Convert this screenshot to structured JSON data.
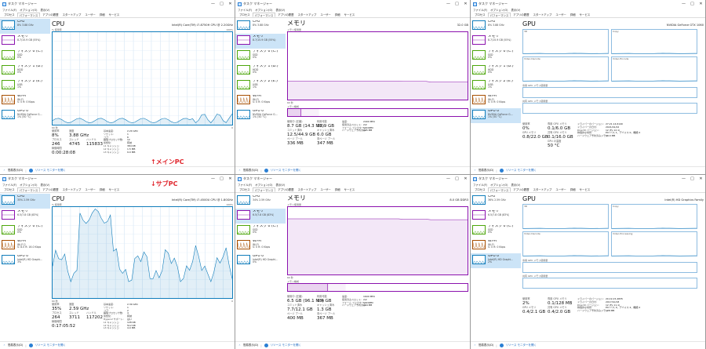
{
  "app": {
    "title": "タスク マネージャー",
    "menu": [
      "ファイル(F)",
      "オプション(O)",
      "表示(V)"
    ],
    "tabs": [
      "プロセス",
      "パフォーマンス",
      "アプリの履歴",
      "スタートアップ",
      "ユーザー",
      "詳細",
      "サービス"
    ],
    "active_tab": "パフォーマンス",
    "controls": [
      "—",
      "□",
      "✕"
    ]
  },
  "footer": {
    "less": "簡易表示(D)",
    "monitor": "リソース モニターを開く"
  },
  "labels": {
    "main_pc": "↑メインPC",
    "sub_pc": "↓サブPC"
  },
  "main_pc": {
    "sidebar": [
      {
        "title": "CPU",
        "sub": "8% 3.88 GHz",
        "kind": "cpu"
      },
      {
        "title": "メモリ",
        "sub": "8.7/15.9 GB (55%)",
        "kind": "mem"
      },
      {
        "title": "ディスク 0 (C:)",
        "sub": "SSD",
        "sub2": "0%",
        "kind": "disk"
      },
      {
        "title": "ディスク 1 (D:)",
        "sub": "HDD",
        "sub2": "0%",
        "kind": "disk"
      },
      {
        "title": "ディスク 2 (E:)",
        "sub": "USB",
        "sub2": "1%",
        "kind": "disk"
      },
      {
        "title": "Wi-Fi",
        "sub": "Wi-Fi",
        "sub2": "S: 0 R: 0 Kbps",
        "kind": "wifi"
      },
      {
        "title": "GPU 0",
        "sub": "NVIDIA GeForce G...",
        "sub2": "1% (50 °C)",
        "kind": "gpu"
      }
    ],
    "cpu": {
      "title": "CPU",
      "device": "Intel(R) Core(TM) i7-8750H CPU @ 2.20GHz",
      "graph_top": "% 使用率",
      "graph_max": "100%",
      "graph_time": "60 秒",
      "graph_min": "0",
      "usage_label": "使用率",
      "usage": "8%",
      "speed_label": "速度",
      "speed": "3.88 GHz",
      "proc_label": "プロセス",
      "proc": "246",
      "thr_label": "スレッド",
      "thr": "4745",
      "hnd_label": "ハンドル",
      "hnd": "115833",
      "uptime_label": "稼働時間",
      "uptime": "0:00:28:08",
      "specs": [
        [
          "基本速度:",
          "2.20 GHz"
        ],
        [
          "ソケット:",
          "1"
        ],
        [
          "コア:",
          "6"
        ],
        [
          "論理プロセッサ数:",
          "12"
        ],
        [
          "仮想化:",
          "有効"
        ],
        [
          "L1 キャッシュ:",
          "384 KB"
        ],
        [
          "L2 キャッシュ:",
          "1.5 MB"
        ],
        [
          "L3 キャッシュ:",
          "9.0 MB"
        ]
      ]
    },
    "mem": {
      "title": "メモリ",
      "total": "32.0 GB",
      "graph_top": "メモリ使用量",
      "graph_time": "60 秒",
      "composition": "メモリ構成",
      "inuse_label": "使用中 (圧縮)",
      "inuse": "8.7 GB (14.3 MB)",
      "avail_label": "利用可能",
      "avail": "22.9 GB",
      "commit_label": "コミット済み",
      "commit": "12.5/44.9 GB",
      "cached_label": "キャッシュ済み",
      "cached": "6.0 GB",
      "paged_label": "ページ プール",
      "paged": "336 MB",
      "nonpaged_label": "非ページ プール",
      "nonpaged": "347 MB",
      "specs": [
        [
          "速度:",
          "2400 MHz"
        ],
        [
          "使用済みスロット:",
          "2/2"
        ],
        [
          "フォーム ファクター:",
          "SODIMM"
        ],
        [
          "ハードウェア予約済み:",
          "105 MB"
        ]
      ]
    },
    "gpu": {
      "title": "GPU",
      "device": "NVIDIA GeForce GTX 1060",
      "engines": [
        "3D",
        "Copy",
        "Video Decode",
        "Video Encode"
      ],
      "shared_label": "共有 GPU メモリ使用量",
      "dedicated_label": "専用 GPU メモリ使用量",
      "usage_label": "使用率",
      "usage": "0%",
      "dedmem_label": "専用 GPU メモリ",
      "dedmem": "0.1/6.0 GB",
      "gpumem_label": "GPU メモリ",
      "gpumem": "0.8/22.0 GB",
      "sharedmem_label": "共有 GPU メモリ",
      "sharedmem": "0.1/16.0 GB",
      "temp_label": "GPU の温度",
      "temp": "50 °C",
      "specs": [
        [
          "ドライバーのバージョン:",
          "27.21.14.6140"
        ],
        [
          "ドライバーの日付:",
          "2021/01/22"
        ],
        [
          "DirectX バージョン:",
          "12 (FL 12.1)"
        ],
        [
          "物理的な場所:",
          "PCI バス 1、デバイス 0、機能 0"
        ],
        [
          "ハードウェア予約済みメモリ:",
          "90.0 MB"
        ]
      ]
    }
  },
  "sub_pc": {
    "sidebar_cpu": [
      {
        "title": "CPU",
        "sub": "35% 2.59 GHz",
        "kind": "cpu"
      },
      {
        "title": "メモリ",
        "sub": "6.5/7.8 GB (83%)",
        "kind": "mem"
      },
      {
        "title": "ディスク 0 (C:)",
        "sub": "SSD",
        "sub2": "0%",
        "kind": "disk"
      },
      {
        "title": "Wi-Fi",
        "sub": "Wi-Fi 2",
        "sub2": "S: 8.0 R: 16.0 Kbps",
        "kind": "wifi"
      },
      {
        "title": "GPU 0",
        "sub": "Intel(R) HD Graphi...",
        "sub2": "3%",
        "kind": "gpu"
      }
    ],
    "sidebar_mem": [
      {
        "title": "CPU",
        "sub": "34% 2.59 GHz",
        "kind": "cpu"
      },
      {
        "title": "メモリ",
        "sub": "6.5/7.8 GB (83%)",
        "kind": "mem"
      },
      {
        "title": "ディスク 0 (C:)",
        "sub": "SSD",
        "sub2": "0%",
        "kind": "disk"
      },
      {
        "title": "Wi-Fi",
        "sub": "Wi-Fi",
        "sub2": "S: 0 R: 0 Kbps",
        "kind": "wifi"
      },
      {
        "title": "GPU 0",
        "sub": "Intel(R) HD Graphi...",
        "sub2": "0%",
        "kind": "gpu"
      }
    ],
    "sidebar_gpu": [
      {
        "title": "CPU",
        "sub": "36% 2.59 GHz",
        "kind": "cpu"
      },
      {
        "title": "メモリ",
        "sub": "6.5/7.8 GB (83%)",
        "kind": "mem"
      },
      {
        "title": "ディスク 0 (C:)",
        "sub": "SSD",
        "sub2": "0%",
        "kind": "disk"
      },
      {
        "title": "Wi-Fi",
        "sub": "Wi-Fi",
        "sub2": "S: 0 R: 0 Kbps",
        "kind": "wifi"
      },
      {
        "title": "GPU 0",
        "sub": "Intel(R) HD Graphi...",
        "sub2": "2%",
        "kind": "gpu"
      }
    ],
    "cpu": {
      "title": "CPU",
      "device": "Intel(R) Core(TM) i7-4500U CPU @ 1.80GHz",
      "graph_top": "% 使用率",
      "graph_max": "100%",
      "graph_time": "60 秒",
      "graph_min": "0",
      "usage_label": "使用率",
      "usage": "35%",
      "speed_label": "速度",
      "speed": "2.59 GHz",
      "proc_label": "プロセス",
      "proc": "264",
      "thr_label": "スレッド",
      "thr": "3711",
      "hnd_label": "ハンドル",
      "hnd": "117202",
      "uptime_label": "稼働時間",
      "uptime": "0:17:05:52",
      "specs": [
        [
          "基本速度:",
          "2.39 GHz"
        ],
        [
          "ソケット:",
          "1"
        ],
        [
          "コア:",
          "2"
        ],
        [
          "論理プロセッサ数:",
          "4"
        ],
        [
          "仮想化:",
          "有効"
        ],
        [
          "Hyper-V サポート:",
          "はい"
        ],
        [
          "L1 キャッシュ:",
          "128 KB"
        ],
        [
          "L2 キャッシュ:",
          "512 KB"
        ],
        [
          "L3 キャッシュ:",
          "4.0 MB"
        ]
      ]
    },
    "mem": {
      "title": "メモリ",
      "total": "8.0 GB DDR3",
      "graph_top": "メモリ使用量",
      "graph_time": "60 秒",
      "composition": "メモリ構成",
      "inuse_label": "使用中 (圧縮)",
      "inuse": "6.5 GB (96.1 MB)",
      "avail_label": "利用可能",
      "avail": "1.4 GB",
      "commit_label": "コミット済み",
      "commit": "7.7/12.1 GB",
      "cached_label": "キャッシュ済み",
      "cached": "1.3 GB",
      "paged_label": "ページ プール",
      "paged": "400 MB",
      "nonpaged_label": "非ページ プール",
      "nonpaged": "367 MB",
      "specs": [
        [
          "速度:",
          "1600 MHz"
        ],
        [
          "使用済みスロット:",
          "2/2"
        ],
        [
          "フォーム ファクター:",
          "SODIMM"
        ],
        [
          "ハードウェア予約済み:",
          "134 MB"
        ]
      ]
    },
    "gpu": {
      "title": "GPU",
      "device": "Intel(R) HD Graphics Family",
      "engines": [
        "3D",
        "Copy",
        "Video Decode",
        "Video Processing"
      ],
      "shared_label": "共有 GPU メモリ使用量",
      "dedicated_label": "専用 GPU メモリ使用量",
      "usage_label": "使用率",
      "usage": "2%",
      "dedmem_label": "専用 GPU メモリ",
      "dedmem": "0.1/128 MB",
      "gpumem_label": "GPU メモリ",
      "gpumem": "0.4/2.1 GB",
      "sharedmem_label": "共有 GPU メモリ",
      "sharedmem": "0.4/2.0 GB",
      "specs": [
        [
          "ドライバーのバージョン:",
          "20.19.15.4835"
        ],
        [
          "ドライバーの日付:",
          "2017/10/18"
        ],
        [
          "DirectX バージョン:",
          "12 (FL 11.1)"
        ],
        [
          "物理的な場所:",
          "PCI バス 0、デバイス 2、機能 0"
        ],
        [
          "ハードウェア予約済みメモリ:",
          "128 MB"
        ]
      ]
    }
  }
}
